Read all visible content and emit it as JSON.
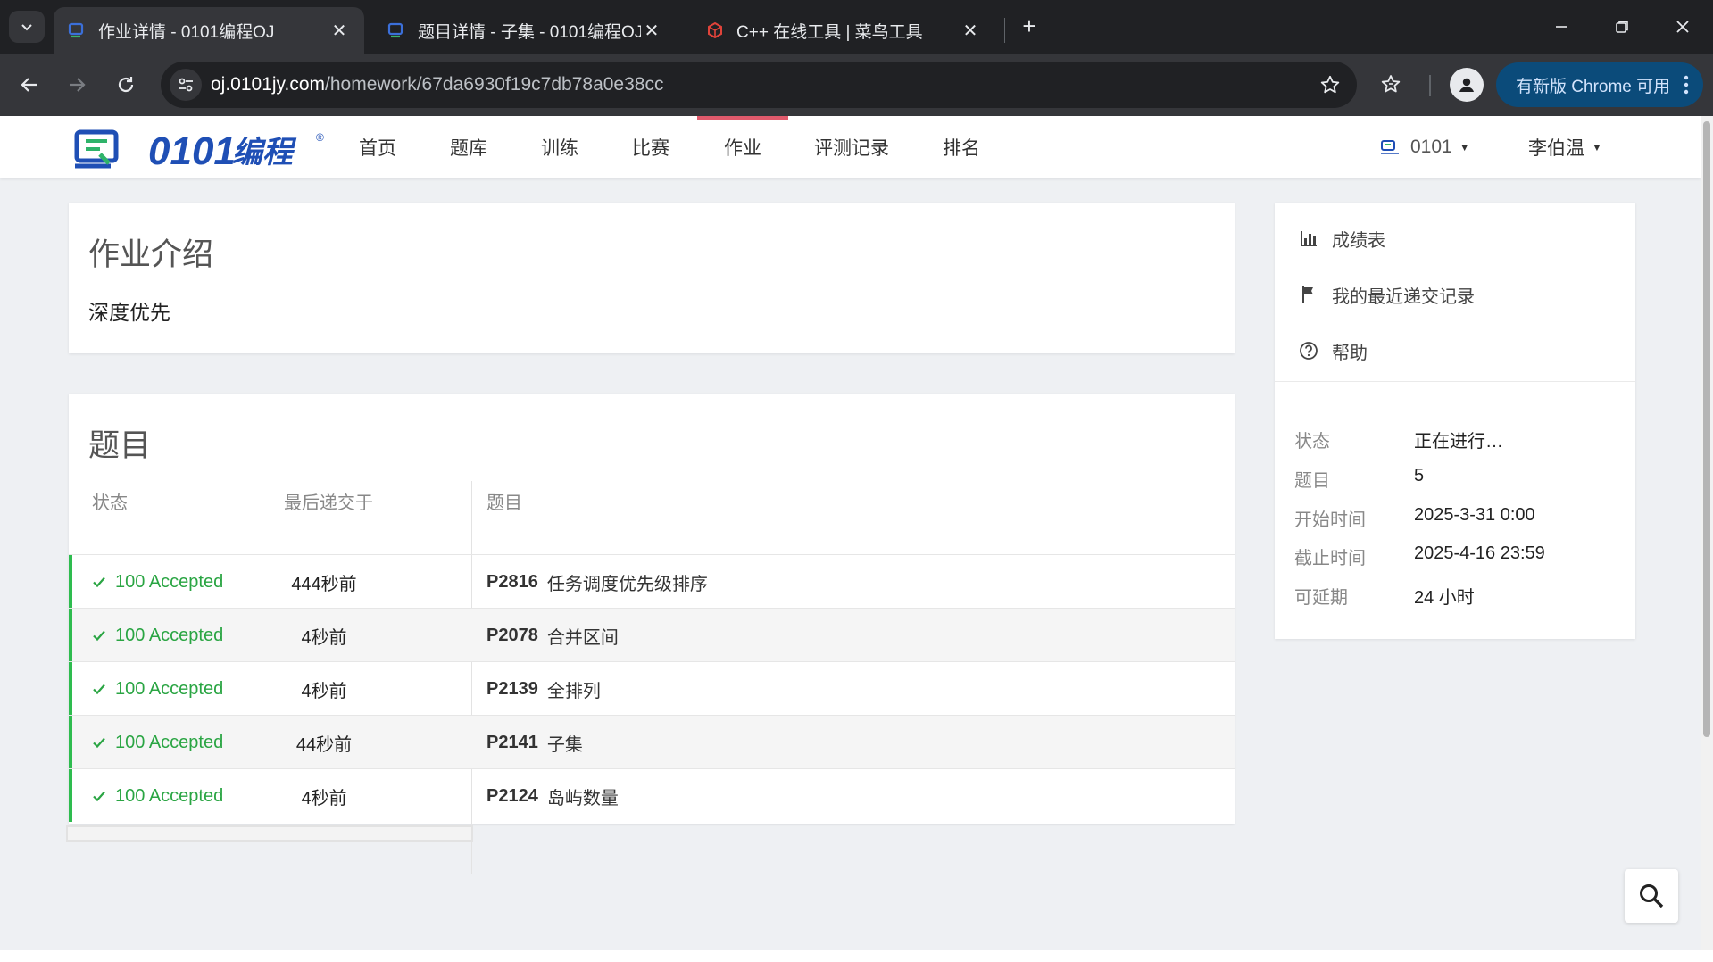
{
  "browser": {
    "tabs": [
      {
        "title": "作业详情 - 0101编程OJ",
        "active": true
      },
      {
        "title": "题目详情 - 子集 - 0101编程OJ",
        "active": false
      },
      {
        "title": "C++ 在线工具 | 菜鸟工具",
        "active": false
      }
    ],
    "url_domain": "oj.0101jy.com",
    "url_path": "/homework/67da6930f19c7db78a0e38cc",
    "update_label": "有新版 Chrome 可用"
  },
  "site": {
    "nav": [
      "首页",
      "题库",
      "训练",
      "比赛",
      "作业",
      "评测记录",
      "排名"
    ],
    "active_nav": "作业",
    "domain_label": "0101",
    "user_name": "李伯温"
  },
  "intro": {
    "title": "作业介绍",
    "body": "深度优先"
  },
  "problems": {
    "title": "题目",
    "headers": {
      "status": "状态",
      "last_submit": "最后递交于",
      "problem": "题目"
    },
    "rows": [
      {
        "status": "100 Accepted",
        "time": "444秒前",
        "pid": "P2816",
        "name": "任务调度优先级排序"
      },
      {
        "status": "100 Accepted",
        "time": "4秒前",
        "pid": "P2078",
        "name": "合并区间"
      },
      {
        "status": "100 Accepted",
        "time": "4秒前",
        "pid": "P2139",
        "name": "全排列"
      },
      {
        "status": "100 Accepted",
        "time": "44秒前",
        "pid": "P2141",
        "name": "子集"
      },
      {
        "status": "100 Accepted",
        "time": "4秒前",
        "pid": "P2124",
        "name": "岛屿数量"
      }
    ]
  },
  "sidebar": {
    "links": [
      {
        "label": "成绩表",
        "icon": "bar-chart-icon"
      },
      {
        "label": "我的最近递交记录",
        "icon": "flag-icon"
      },
      {
        "label": "帮助",
        "icon": "help-circle-icon"
      }
    ],
    "info": [
      {
        "label": "状态",
        "value": "正在进行…"
      },
      {
        "label": "题目",
        "value": "5"
      },
      {
        "label": "开始时间",
        "value": "2025-3-31 0:00"
      },
      {
        "label": "截止时间",
        "value": "2025-4-16 23:59"
      },
      {
        "label": "可延期",
        "value": "24 小时"
      }
    ]
  },
  "colors": {
    "accepted": "#2aa543",
    "accent_bar": "#2ebc4f",
    "active_nav": "#e05a6c",
    "chrome_dark": "#202124",
    "update_chip": "#0b4b7a"
  }
}
